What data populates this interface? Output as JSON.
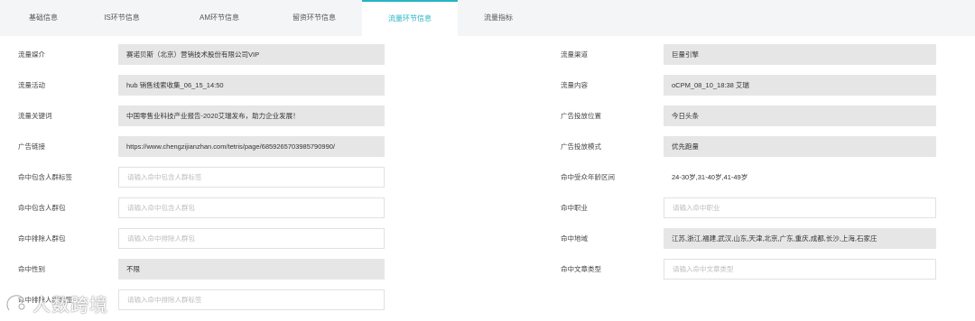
{
  "tabs": [
    {
      "label": "基础信息",
      "active": false
    },
    {
      "label": "IS环节信息",
      "active": false
    },
    {
      "label": "AM环节信息",
      "active": false
    },
    {
      "label": "留资环节信息",
      "active": false
    },
    {
      "label": "流量环节信息",
      "active": true
    },
    {
      "label": "流量指标",
      "active": false
    }
  ],
  "colors": {
    "accent": "#27b5c4",
    "readonly_bg": "#e6e6e6",
    "tabbar_bg": "#f4f5f7"
  },
  "left": [
    {
      "label": "流量媒介",
      "value": "赛诺贝斯（北京）营销技术股份有限公司VIP"
    },
    {
      "label": "流量活动",
      "value": "hub 销售线索收集_06_15_14:50"
    },
    {
      "label": "流量关键词",
      "value": "中国零售业科技产业报告-2020艾瑞发布，助力企业发展！"
    },
    {
      "label": "广告链接",
      "value": "https://www.chengzijianzhan.com/tetris/page/6859265703985790990/"
    },
    {
      "label": "命中包含人群标签",
      "placeholder": "请输入命中包含人群标签"
    },
    {
      "label": "命中包含人群包",
      "placeholder": "请输入命中包含人群包"
    },
    {
      "label": "命中排除人群包",
      "placeholder": "请输入命中排除人群包"
    },
    {
      "label": "命中性别",
      "value": "不限"
    },
    {
      "label": "命中排除人群标签",
      "placeholder": "请输入命中排除人群标签"
    }
  ],
  "right": [
    {
      "label": "流量渠道",
      "value": "巨量引擎"
    },
    {
      "label": "流量内容",
      "value": "oCPM_08_10_18:38 艾瑞"
    },
    {
      "label": "广告投放位置",
      "value": "今日头条"
    },
    {
      "label": "广告投放模式",
      "value": "优先跑量"
    },
    {
      "label": "命中受众年龄区间",
      "value": "24-30岁,31-40岁,41-49岁"
    },
    {
      "label": "命中职业",
      "placeholder": "请输入命中职业"
    },
    {
      "label": "命中地域",
      "value": "江苏,浙江,福建,武汉,山东,天津,北京,广东,重庆,成都,长沙,上海,石家庄"
    },
    {
      "label": "命中文章类型",
      "placeholder": "请输入命中文章类型"
    }
  ],
  "watermark": {
    "text": "人数跨境"
  }
}
